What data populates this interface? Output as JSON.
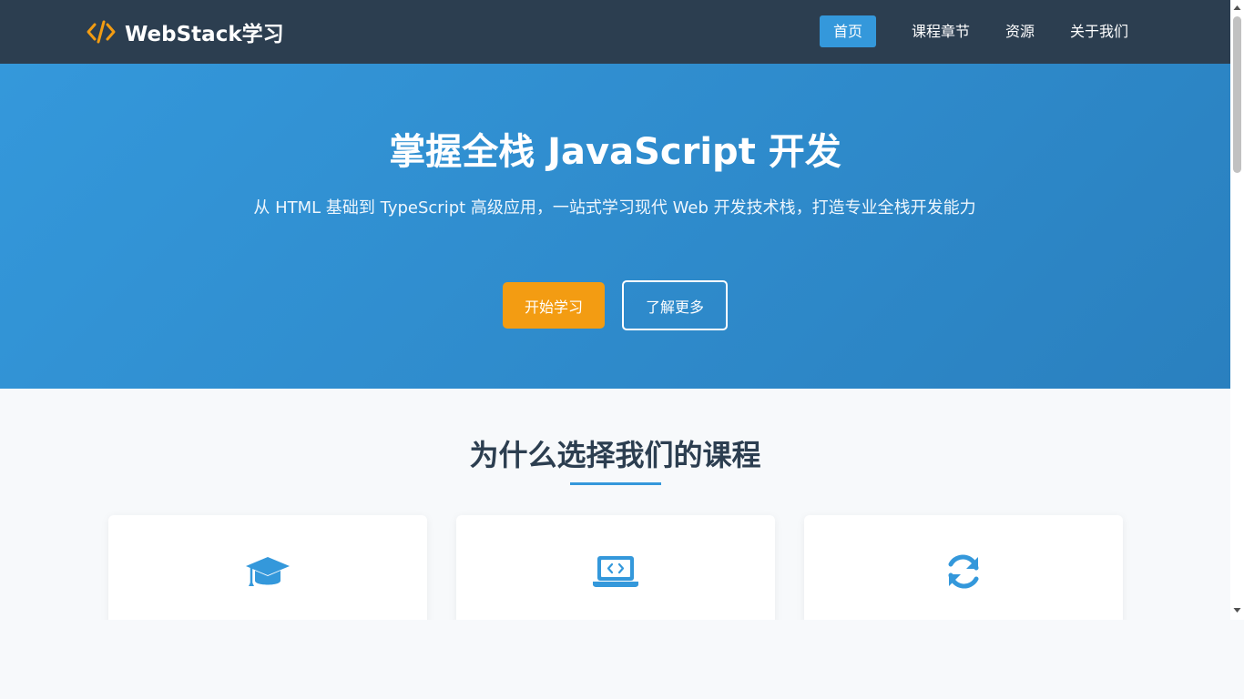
{
  "brand": {
    "name": "WebStack学习",
    "icon": "code-icon",
    "icon_color": "#f39c12"
  },
  "nav": {
    "items": [
      {
        "label": "首页",
        "active": true
      },
      {
        "label": "课程章节",
        "active": false
      },
      {
        "label": "资源",
        "active": false
      },
      {
        "label": "关于我们",
        "active": false
      }
    ]
  },
  "hero": {
    "title": "掌握全栈 JavaScript 开发",
    "subtitle": "从 HTML 基础到 TypeScript 高级应用，一站式学习现代 Web 开发技术栈，打造专业全栈开发能力",
    "primary_button": "开始学习",
    "secondary_button": "了解更多"
  },
  "features": {
    "title": "为什么选择我们的课程",
    "cards": [
      {
        "icon": "graduation-cap-icon"
      },
      {
        "icon": "laptop-code-icon"
      },
      {
        "icon": "sync-icon"
      }
    ]
  },
  "colors": {
    "header_bg": "#2c3e50",
    "accent": "#3498db",
    "cta": "#f39c12"
  }
}
